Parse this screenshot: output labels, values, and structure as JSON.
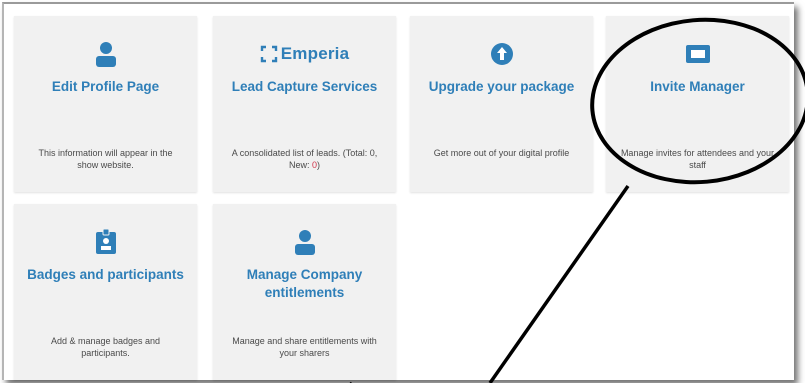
{
  "cards": [
    {
      "title": "Edit Profile Page",
      "desc": "This information will appear in the show website.",
      "icon": "person-icon"
    },
    {
      "brand": "Emperia",
      "title": "Lead Capture Services",
      "desc_prefix": "A consolidated list of leads. (Total: 0, New: ",
      "desc_new": "0",
      "desc_suffix": ")",
      "icon": "emperia-logo"
    },
    {
      "title": "Upgrade your package",
      "desc": "Get more out of your digital profile",
      "icon": "arrow-up-circle-icon"
    },
    {
      "title": "Invite Manager",
      "desc": "Manage invites for attendees and your staff",
      "icon": "ticket-icon"
    },
    {
      "title": "Badges and participants",
      "desc": "Add & manage badges and participants.",
      "icon": "badge-icon"
    },
    {
      "title": "Manage Company entitlements",
      "desc": "Manage and share entitlements with your sharers",
      "icon": "person-icon"
    }
  ],
  "colors": {
    "accent": "#2f7fb8",
    "new_count": "#d0354b",
    "card_bg": "#f1f1f1",
    "text": "#4a4a4a"
  }
}
